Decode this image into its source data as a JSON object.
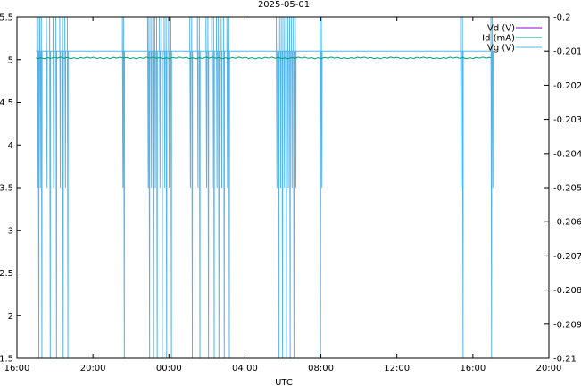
{
  "chart_data": {
    "type": "line",
    "title": "2025-05-01",
    "xlabel": "UTC",
    "ylabel": "",
    "y2label": "",
    "x_ticks": [
      "16:00",
      "20:00",
      "00:00",
      "04:00",
      "08:00",
      "12:00",
      "16:00",
      "20:00"
    ],
    "x_range_hours": [
      0,
      28
    ],
    "y_left_ticks": [
      "1.5",
      "2",
      "2.5",
      "3",
      "3.5",
      "4",
      "4.5",
      "5",
      "5.5"
    ],
    "ylim_left": [
      1.5,
      5.5
    ],
    "y_right_ticks": [
      "-0.21",
      "-0.209",
      "-0.208",
      "-0.207",
      "-0.206",
      "-0.205",
      "-0.204",
      "-0.203",
      "-0.202",
      "-0.201",
      "-0.2"
    ],
    "ylim_right": [
      -0.21,
      -0.2
    ],
    "legend_position": "top-right",
    "grid": false,
    "series": [
      {
        "name": "Vd (V)",
        "color": "#9400d3",
        "axis": "left",
        "values": []
      },
      {
        "name": "Id (mA)",
        "color": "#009e73",
        "axis": "left",
        "x_start_hours": 1.0,
        "x_end_hours": 25.0,
        "level": 5.02
      },
      {
        "name": "Vg (V)",
        "color": "#56b4e9",
        "axis": "right",
        "baseline": -0.201,
        "spike_levels": [
          -0.2,
          -0.205,
          -0.21
        ],
        "spikes": [
          {
            "t": 1.05,
            "d": 1
          },
          {
            "t": 1.12,
            "d": 2
          },
          {
            "t": 1.2,
            "d": 1
          },
          {
            "t": 1.28,
            "d": 2
          },
          {
            "t": 1.55,
            "d": 1
          },
          {
            "t": 1.72,
            "d": 2
          },
          {
            "t": 1.9,
            "d": 1
          },
          {
            "t": 2.05,
            "d": 2
          },
          {
            "t": 2.25,
            "d": 1
          },
          {
            "t": 2.4,
            "d": 2
          },
          {
            "t": 2.52,
            "d": 1
          },
          {
            "t": 2.65,
            "d": 2
          },
          {
            "t": 5.55,
            "d": 1
          },
          {
            "t": 5.62,
            "d": 2
          },
          {
            "t": 6.88,
            "d": 1
          },
          {
            "t": 6.95,
            "d": 2
          },
          {
            "t": 7.05,
            "d": 1
          },
          {
            "t": 7.15,
            "d": 2
          },
          {
            "t": 7.25,
            "d": 1
          },
          {
            "t": 7.35,
            "d": 2
          },
          {
            "t": 7.5,
            "d": 1
          },
          {
            "t": 7.62,
            "d": 2
          },
          {
            "t": 7.75,
            "d": 1
          },
          {
            "t": 7.85,
            "d": 2
          },
          {
            "t": 7.98,
            "d": 1
          },
          {
            "t": 8.1,
            "d": 2
          },
          {
            "t": 9.1,
            "d": 1
          },
          {
            "t": 9.2,
            "d": 2
          },
          {
            "t": 9.5,
            "d": 1
          },
          {
            "t": 9.6,
            "d": 2
          },
          {
            "t": 9.95,
            "d": 1
          },
          {
            "t": 10.05,
            "d": 2
          },
          {
            "t": 10.25,
            "d": 1
          },
          {
            "t": 10.35,
            "d": 2
          },
          {
            "t": 10.5,
            "d": 1
          },
          {
            "t": 10.6,
            "d": 2
          },
          {
            "t": 10.75,
            "d": 1
          },
          {
            "t": 10.88,
            "d": 2
          },
          {
            "t": 11.05,
            "d": 1
          },
          {
            "t": 11.15,
            "d": 2
          },
          {
            "t": 13.65,
            "d": 1
          },
          {
            "t": 13.75,
            "d": 2
          },
          {
            "t": 13.85,
            "d": 1
          },
          {
            "t": 13.95,
            "d": 2
          },
          {
            "t": 14.05,
            "d": 1
          },
          {
            "t": 14.15,
            "d": 2
          },
          {
            "t": 14.25,
            "d": 1
          },
          {
            "t": 14.35,
            "d": 2
          },
          {
            "t": 14.45,
            "d": 1
          },
          {
            "t": 14.55,
            "d": 2
          },
          {
            "t": 14.65,
            "d": 1
          },
          {
            "t": 15.95,
            "d": 2
          },
          {
            "t": 16.02,
            "d": 1
          },
          {
            "t": 23.35,
            "d": 1
          },
          {
            "t": 23.45,
            "d": 2
          },
          {
            "t": 24.95,
            "d": 2
          },
          {
            "t": 25.02,
            "d": 1
          }
        ]
      }
    ]
  }
}
